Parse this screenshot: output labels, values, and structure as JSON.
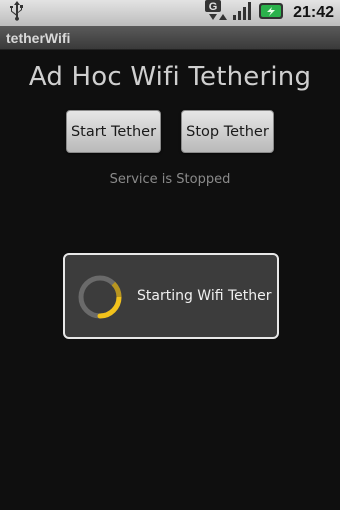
{
  "status_bar": {
    "time": "21:42",
    "icons": [
      "usb-icon",
      "network-g-icon",
      "signal-icon",
      "battery-charging-icon"
    ],
    "battery_color": "#2bb24c"
  },
  "app": {
    "title": "tetherWifi"
  },
  "main": {
    "heading": "Ad Hoc Wifi Tethering",
    "start_button": "Start Tether",
    "stop_button": "Stop Tether",
    "service_status": "Service is Stopped"
  },
  "dialog": {
    "message": "Starting Wifi Tether",
    "spinner_color": "#f2c21b"
  }
}
